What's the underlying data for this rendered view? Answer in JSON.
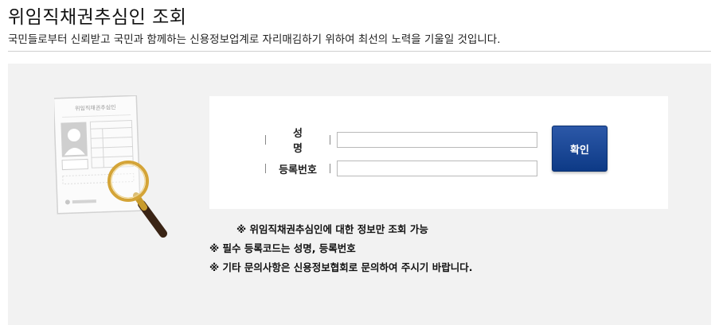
{
  "header": {
    "title": "위임직채권추심인 조회",
    "subtitle": "국민들로부터 신뢰받고 국민과 함께하는 신용정보업계로 자리매김하기 위하여 최선의 노력을 기울일 것입니다."
  },
  "illustration": {
    "card_title": "위임직채권추심인",
    "icon": "id-card-with-magnifier-icon"
  },
  "form": {
    "name_label": "성명",
    "name_value": "",
    "registration_label": "등록번호",
    "registration_value": "",
    "confirm_label": "확인"
  },
  "notes": [
    "※ 위임직채권추심인에 대한 정보만 조회 가능",
    "※ 필수 등록코드는 성명, 등록번호",
    "※ 기타 문의사항은 신용정보협회로 문의하여 주시기 바랍니다."
  ],
  "colors": {
    "button": "#1c4a98",
    "panel_background": "#f2f2f2",
    "magnifier_rim": "#d4a437"
  }
}
